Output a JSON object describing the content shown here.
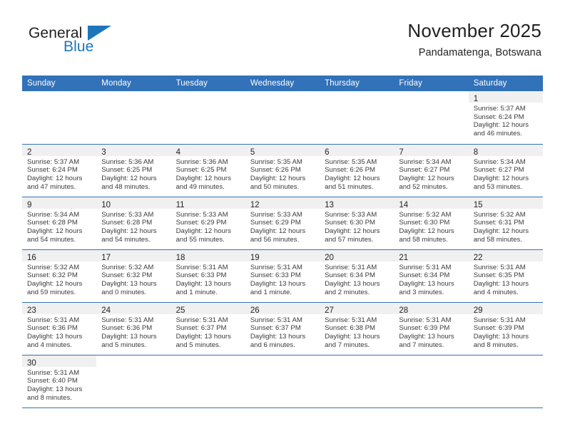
{
  "brand": {
    "name_part1": "General",
    "name_part2": "Blue",
    "flag_icon": "triangle-flag-icon"
  },
  "header": {
    "title": "November 2025",
    "subtitle": "Pandamatenga, Botswana"
  },
  "calendar": {
    "weekday_headers": [
      "Sunday",
      "Monday",
      "Tuesday",
      "Wednesday",
      "Thursday",
      "Friday",
      "Saturday"
    ],
    "accent_color": "#3272b8",
    "daynum_band_color": "#f0f0f0",
    "weeks": [
      [
        {
          "day": "",
          "lines": []
        },
        {
          "day": "",
          "lines": []
        },
        {
          "day": "",
          "lines": []
        },
        {
          "day": "",
          "lines": []
        },
        {
          "day": "",
          "lines": []
        },
        {
          "day": "",
          "lines": []
        },
        {
          "day": "1",
          "lines": [
            "Sunrise: 5:37 AM",
            "Sunset: 6:24 PM",
            "Daylight: 12 hours",
            "and 46 minutes."
          ]
        }
      ],
      [
        {
          "day": "2",
          "lines": [
            "Sunrise: 5:37 AM",
            "Sunset: 6:24 PM",
            "Daylight: 12 hours",
            "and 47 minutes."
          ]
        },
        {
          "day": "3",
          "lines": [
            "Sunrise: 5:36 AM",
            "Sunset: 6:25 PM",
            "Daylight: 12 hours",
            "and 48 minutes."
          ]
        },
        {
          "day": "4",
          "lines": [
            "Sunrise: 5:36 AM",
            "Sunset: 6:25 PM",
            "Daylight: 12 hours",
            "and 49 minutes."
          ]
        },
        {
          "day": "5",
          "lines": [
            "Sunrise: 5:35 AM",
            "Sunset: 6:26 PM",
            "Daylight: 12 hours",
            "and 50 minutes."
          ]
        },
        {
          "day": "6",
          "lines": [
            "Sunrise: 5:35 AM",
            "Sunset: 6:26 PM",
            "Daylight: 12 hours",
            "and 51 minutes."
          ]
        },
        {
          "day": "7",
          "lines": [
            "Sunrise: 5:34 AM",
            "Sunset: 6:27 PM",
            "Daylight: 12 hours",
            "and 52 minutes."
          ]
        },
        {
          "day": "8",
          "lines": [
            "Sunrise: 5:34 AM",
            "Sunset: 6:27 PM",
            "Daylight: 12 hours",
            "and 53 minutes."
          ]
        }
      ],
      [
        {
          "day": "9",
          "lines": [
            "Sunrise: 5:34 AM",
            "Sunset: 6:28 PM",
            "Daylight: 12 hours",
            "and 54 minutes."
          ]
        },
        {
          "day": "10",
          "lines": [
            "Sunrise: 5:33 AM",
            "Sunset: 6:28 PM",
            "Daylight: 12 hours",
            "and 54 minutes."
          ]
        },
        {
          "day": "11",
          "lines": [
            "Sunrise: 5:33 AM",
            "Sunset: 6:29 PM",
            "Daylight: 12 hours",
            "and 55 minutes."
          ]
        },
        {
          "day": "12",
          "lines": [
            "Sunrise: 5:33 AM",
            "Sunset: 6:29 PM",
            "Daylight: 12 hours",
            "and 56 minutes."
          ]
        },
        {
          "day": "13",
          "lines": [
            "Sunrise: 5:33 AM",
            "Sunset: 6:30 PM",
            "Daylight: 12 hours",
            "and 57 minutes."
          ]
        },
        {
          "day": "14",
          "lines": [
            "Sunrise: 5:32 AM",
            "Sunset: 6:30 PM",
            "Daylight: 12 hours",
            "and 58 minutes."
          ]
        },
        {
          "day": "15",
          "lines": [
            "Sunrise: 5:32 AM",
            "Sunset: 6:31 PM",
            "Daylight: 12 hours",
            "and 58 minutes."
          ]
        }
      ],
      [
        {
          "day": "16",
          "lines": [
            "Sunrise: 5:32 AM",
            "Sunset: 6:32 PM",
            "Daylight: 12 hours",
            "and 59 minutes."
          ]
        },
        {
          "day": "17",
          "lines": [
            "Sunrise: 5:32 AM",
            "Sunset: 6:32 PM",
            "Daylight: 13 hours",
            "and 0 minutes."
          ]
        },
        {
          "day": "18",
          "lines": [
            "Sunrise: 5:31 AM",
            "Sunset: 6:33 PM",
            "Daylight: 13 hours",
            "and 1 minute."
          ]
        },
        {
          "day": "19",
          "lines": [
            "Sunrise: 5:31 AM",
            "Sunset: 6:33 PM",
            "Daylight: 13 hours",
            "and 1 minute."
          ]
        },
        {
          "day": "20",
          "lines": [
            "Sunrise: 5:31 AM",
            "Sunset: 6:34 PM",
            "Daylight: 13 hours",
            "and 2 minutes."
          ]
        },
        {
          "day": "21",
          "lines": [
            "Sunrise: 5:31 AM",
            "Sunset: 6:34 PM",
            "Daylight: 13 hours",
            "and 3 minutes."
          ]
        },
        {
          "day": "22",
          "lines": [
            "Sunrise: 5:31 AM",
            "Sunset: 6:35 PM",
            "Daylight: 13 hours",
            "and 4 minutes."
          ]
        }
      ],
      [
        {
          "day": "23",
          "lines": [
            "Sunrise: 5:31 AM",
            "Sunset: 6:36 PM",
            "Daylight: 13 hours",
            "and 4 minutes."
          ]
        },
        {
          "day": "24",
          "lines": [
            "Sunrise: 5:31 AM",
            "Sunset: 6:36 PM",
            "Daylight: 13 hours",
            "and 5 minutes."
          ]
        },
        {
          "day": "25",
          "lines": [
            "Sunrise: 5:31 AM",
            "Sunset: 6:37 PM",
            "Daylight: 13 hours",
            "and 5 minutes."
          ]
        },
        {
          "day": "26",
          "lines": [
            "Sunrise: 5:31 AM",
            "Sunset: 6:37 PM",
            "Daylight: 13 hours",
            "and 6 minutes."
          ]
        },
        {
          "day": "27",
          "lines": [
            "Sunrise: 5:31 AM",
            "Sunset: 6:38 PM",
            "Daylight: 13 hours",
            "and 7 minutes."
          ]
        },
        {
          "day": "28",
          "lines": [
            "Sunrise: 5:31 AM",
            "Sunset: 6:39 PM",
            "Daylight: 13 hours",
            "and 7 minutes."
          ]
        },
        {
          "day": "29",
          "lines": [
            "Sunrise: 5:31 AM",
            "Sunset: 6:39 PM",
            "Daylight: 13 hours",
            "and 8 minutes."
          ]
        }
      ],
      [
        {
          "day": "30",
          "lines": [
            "Sunrise: 5:31 AM",
            "Sunset: 6:40 PM",
            "Daylight: 13 hours",
            "and 8 minutes."
          ]
        },
        {
          "day": "",
          "lines": []
        },
        {
          "day": "",
          "lines": []
        },
        {
          "day": "",
          "lines": []
        },
        {
          "day": "",
          "lines": []
        },
        {
          "day": "",
          "lines": []
        },
        {
          "day": "",
          "lines": []
        }
      ]
    ]
  }
}
